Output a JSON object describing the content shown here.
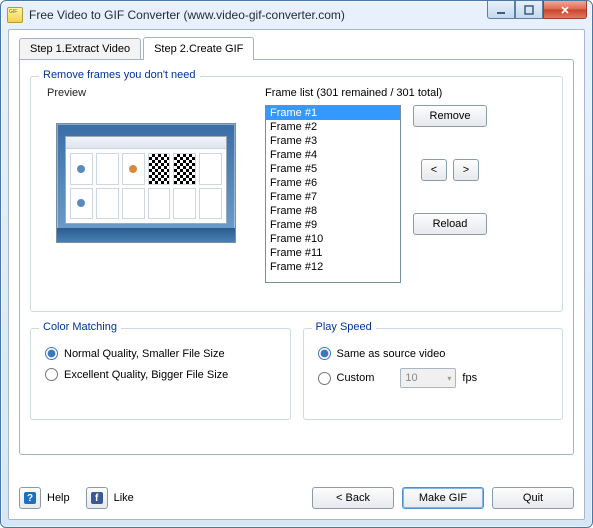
{
  "window": {
    "title": "Free Video to GIF Converter (www.video-gif-converter.com)"
  },
  "tabs": {
    "t1": "Step 1.Extract Video",
    "t2": "Step 2.Create GIF"
  },
  "group_frames": {
    "legend": "Remove frames you don't need",
    "preview_label": "Preview",
    "list_label": "Frame list (301 remained / 301 total)",
    "items": [
      "Frame #1",
      "Frame #2",
      "Frame #3",
      "Frame #4",
      "Frame #5",
      "Frame #6",
      "Frame #7",
      "Frame #8",
      "Frame #9",
      "Frame #10",
      "Frame #11",
      "Frame #12"
    ],
    "remove": "Remove",
    "prev": "<",
    "next": ">",
    "reload": "Reload"
  },
  "group_color": {
    "legend": "Color Matching",
    "opt1": "Normal Quality, Smaller File Size",
    "opt2": "Excellent Quality, Bigger File Size"
  },
  "group_speed": {
    "legend": "Play Speed",
    "opt1": "Same as source video",
    "opt2": "Custom",
    "fps_value": "10",
    "fps_unit": "fps"
  },
  "bottom": {
    "help": "Help",
    "like": "Like",
    "back": "< Back",
    "make": "Make GIF",
    "quit": "Quit"
  }
}
